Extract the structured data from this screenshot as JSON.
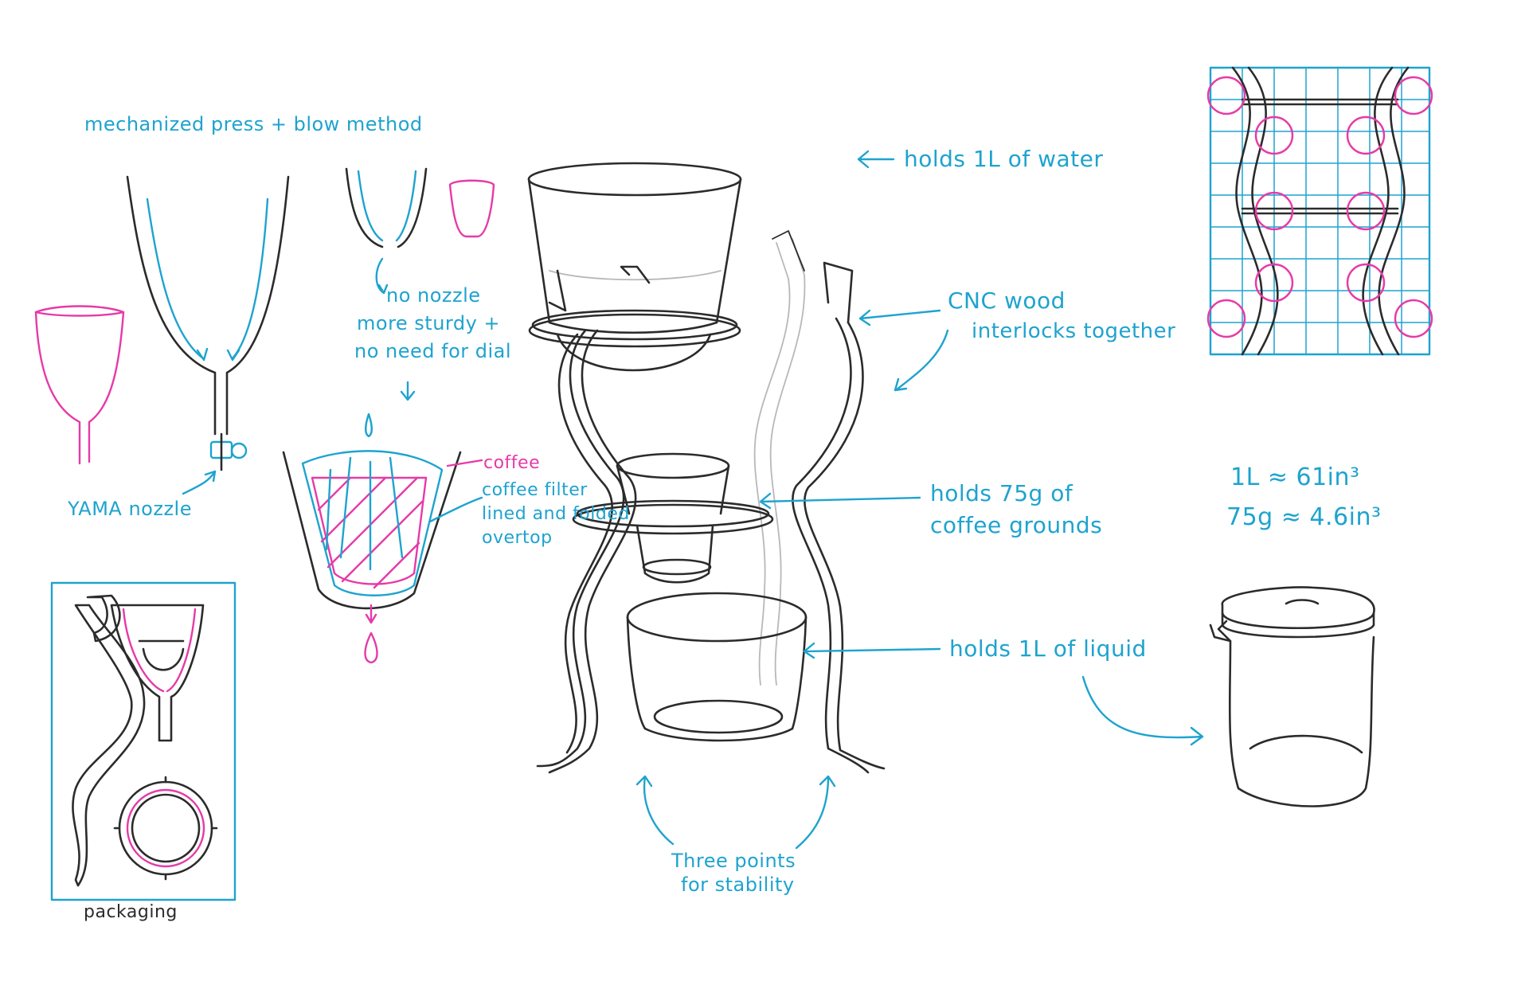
{
  "colors": {
    "ink": "#2b2b2b",
    "annotation": "#1ea3cf",
    "accent": "#e63aa8"
  },
  "labels": {
    "method": "mechanized press + blow method",
    "no_nozzle_1": "no nozzle",
    "no_nozzle_2": "more sturdy +",
    "no_nozzle_3": "no need for dial",
    "yama_nozzle": "YAMA nozzle",
    "coffee": "coffee",
    "filter_1": "coffee filter",
    "filter_2": "lined and folded",
    "filter_3": "overtop",
    "packaging": "packaging",
    "holds_water": "holds 1L of water",
    "cnc_1": "CNC wood",
    "cnc_2": "interlocks together",
    "grounds_1": "holds 75g of",
    "grounds_2": "coffee grounds",
    "liquid": "holds 1L of liquid",
    "stability_1": "Three points",
    "stability_2": "for stability",
    "conv_1": "1L ≈ 61in³",
    "conv_2": "75g ≈ 4.6in³"
  }
}
